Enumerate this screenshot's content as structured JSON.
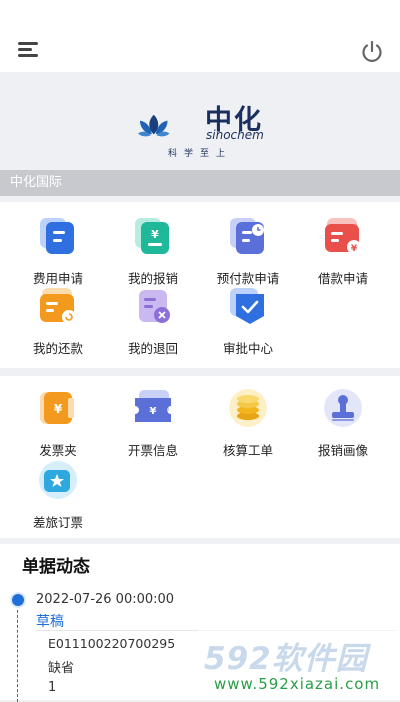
{
  "header": {
    "menu_icon": "hamburger-menu-icon",
    "power_icon": "power-icon"
  },
  "banner": {
    "logo_cn": "中化",
    "logo_en": "sinochem",
    "logo_tagline": "科学至上",
    "label": "中化国际",
    "brand_color": "#1b2f5e"
  },
  "apply_grid": [
    {
      "label": "费用申请",
      "icon": "expense-doc-icon",
      "color": "#2f6fe0"
    },
    {
      "label": "我的报销",
      "icon": "reimburse-doc-icon",
      "color": "#1fb89a"
    },
    {
      "label": "预付款申请",
      "icon": "prepay-doc-clock-icon",
      "color": "#5b6fd8"
    },
    {
      "label": "借款申请",
      "icon": "loan-card-icon",
      "color": "#e9504c"
    },
    {
      "label": "我的还款",
      "icon": "repay-card-icon",
      "color": "#f39a1e"
    },
    {
      "label": "我的退回",
      "icon": "returned-doc-icon",
      "color": "#8e6fd8"
    },
    {
      "label": "审批中心",
      "icon": "approval-check-icon",
      "color": "#2f6fe0"
    }
  ],
  "tools_grid": [
    {
      "label": "发票夹",
      "icon": "invoice-folder-icon",
      "color": "#f39a1e"
    },
    {
      "label": "开票信息",
      "icon": "invoice-ticket-icon",
      "color": "#5b6fd8"
    },
    {
      "label": "核算工单",
      "icon": "coins-icon",
      "color": "#f2b51e"
    },
    {
      "label": "报销画像",
      "icon": "stamp-icon",
      "color": "#5b6fd8"
    },
    {
      "label": "差旅订票",
      "icon": "travel-ticket-icon",
      "color": "#2fa8e0"
    }
  ],
  "documents": {
    "title": "单据动态",
    "items": [
      {
        "date": "2022-07-26 00:00:00",
        "status": "草稿",
        "number": "E011100220700295",
        "type": "缺省",
        "count": "1"
      }
    ]
  },
  "watermark": {
    "brand": "592软件园",
    "url": "www.592xiazai.com"
  },
  "colors": {
    "accent": "#1e6fd8",
    "background": "#eef0f4"
  }
}
